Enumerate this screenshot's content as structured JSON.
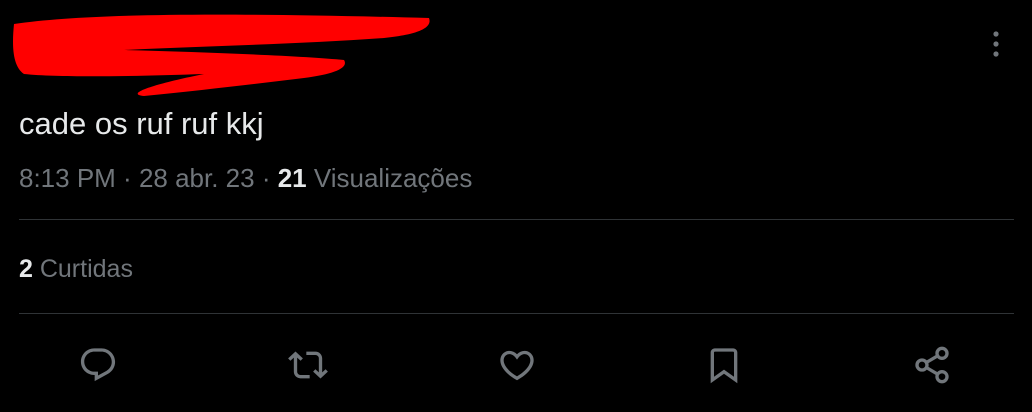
{
  "tweet": {
    "text": "cade os ruf ruf kkj",
    "time": "8:13 PM",
    "separator": " · ",
    "date": "28 abr. 23",
    "views_count": "21",
    "views_label": " Visualizações"
  },
  "engagement": {
    "likes_count": "2",
    "likes_label": " Curtidas"
  },
  "actions": {
    "reply": "reply-icon",
    "retweet": "retweet-icon",
    "like": "heart-icon",
    "bookmark": "bookmark-icon",
    "share": "share-icon"
  },
  "colors": {
    "background": "#000000",
    "text_primary": "#e7e9ea",
    "text_secondary": "#71767b",
    "icon": "#71767b",
    "divider": "#2f3336",
    "redaction": "#ff0000"
  }
}
